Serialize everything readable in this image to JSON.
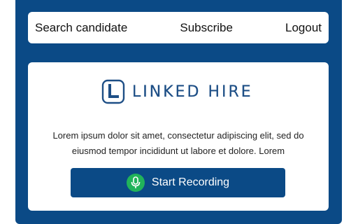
{
  "nav": {
    "search_label": "Search candidate",
    "subscribe_label": "Subscribe",
    "logout_label": "Logout"
  },
  "brand": {
    "name": "LINKED HIRE",
    "color": "#1e4f86"
  },
  "main": {
    "description": "Lorem ipsum dolor sit amet, consectetur adipiscing elit, sed do eiusmod tempor incididunt ut labore et dolore. Lorem",
    "record_button_label": "Start Recording",
    "record_icon": "microphone-icon"
  },
  "colors": {
    "primary": "#0b4a86",
    "mic_green": "#21b35a",
    "surface": "#ffffff"
  }
}
